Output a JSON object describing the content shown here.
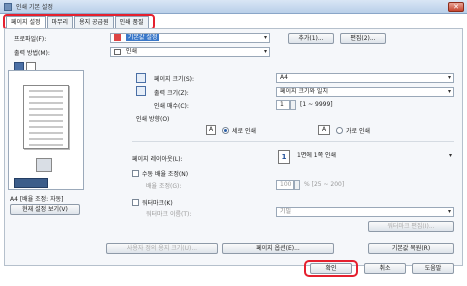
{
  "window": {
    "title": "인쇄 기본 설정",
    "close_glyph": "✕"
  },
  "tabs": [
    {
      "label": "페이지 설정",
      "active": true
    },
    {
      "label": "마무리",
      "active": false
    },
    {
      "label": "용지 공급원",
      "active": false
    },
    {
      "label": "인쇄 품질",
      "active": false
    }
  ],
  "profile": {
    "label": "프로파일(F):",
    "value": "기본값 설정",
    "add_button": "추가(1)...",
    "edit_button": "편집(2)..."
  },
  "output": {
    "label": "출력 방법(M):",
    "value": "인쇄"
  },
  "page_size": {
    "label": "페이지 크기(S):",
    "value": "A4"
  },
  "output_size": {
    "label": "출력 크기(Z):",
    "value": "페이지 크기와 일치"
  },
  "copies": {
    "label": "인쇄 매수(C):",
    "value": "1",
    "range": "[1 ~ 9999]"
  },
  "orientation": {
    "label": "인쇄 방향(O)",
    "portrait": "세로 인쇄",
    "landscape": "가로 인쇄",
    "glyph": "A"
  },
  "layout": {
    "label": "페이지 레이아웃(L):",
    "value": "1면에 1쪽 인쇄",
    "badge": "1"
  },
  "manual_scaling": {
    "label": "수동 배율 조정(N)",
    "scale_label": "배율 조정(G):",
    "scale_value": "100",
    "scale_range": "% [25 ~ 200]"
  },
  "watermark": {
    "label": "워터마크(K)",
    "name_label": "워터마크 이름(T):",
    "value": "기밀",
    "edit_button": "워터마크 편집(I)..."
  },
  "preview": {
    "caption": "A4 [배율 조정: 자동]",
    "view_button": "현재 설정 보기(V)"
  },
  "bottom_buttons": {
    "custom_paper": "사용자 정의 용지 크기(U)...",
    "page_options": "페이지 옵션(E)...",
    "restore": "기본값 복원(R)"
  },
  "dialog": {
    "ok": "확인",
    "cancel": "취소",
    "help": "도움말"
  },
  "colors": {
    "highlight": "#e5202e",
    "accent": "#2a5fa8"
  }
}
